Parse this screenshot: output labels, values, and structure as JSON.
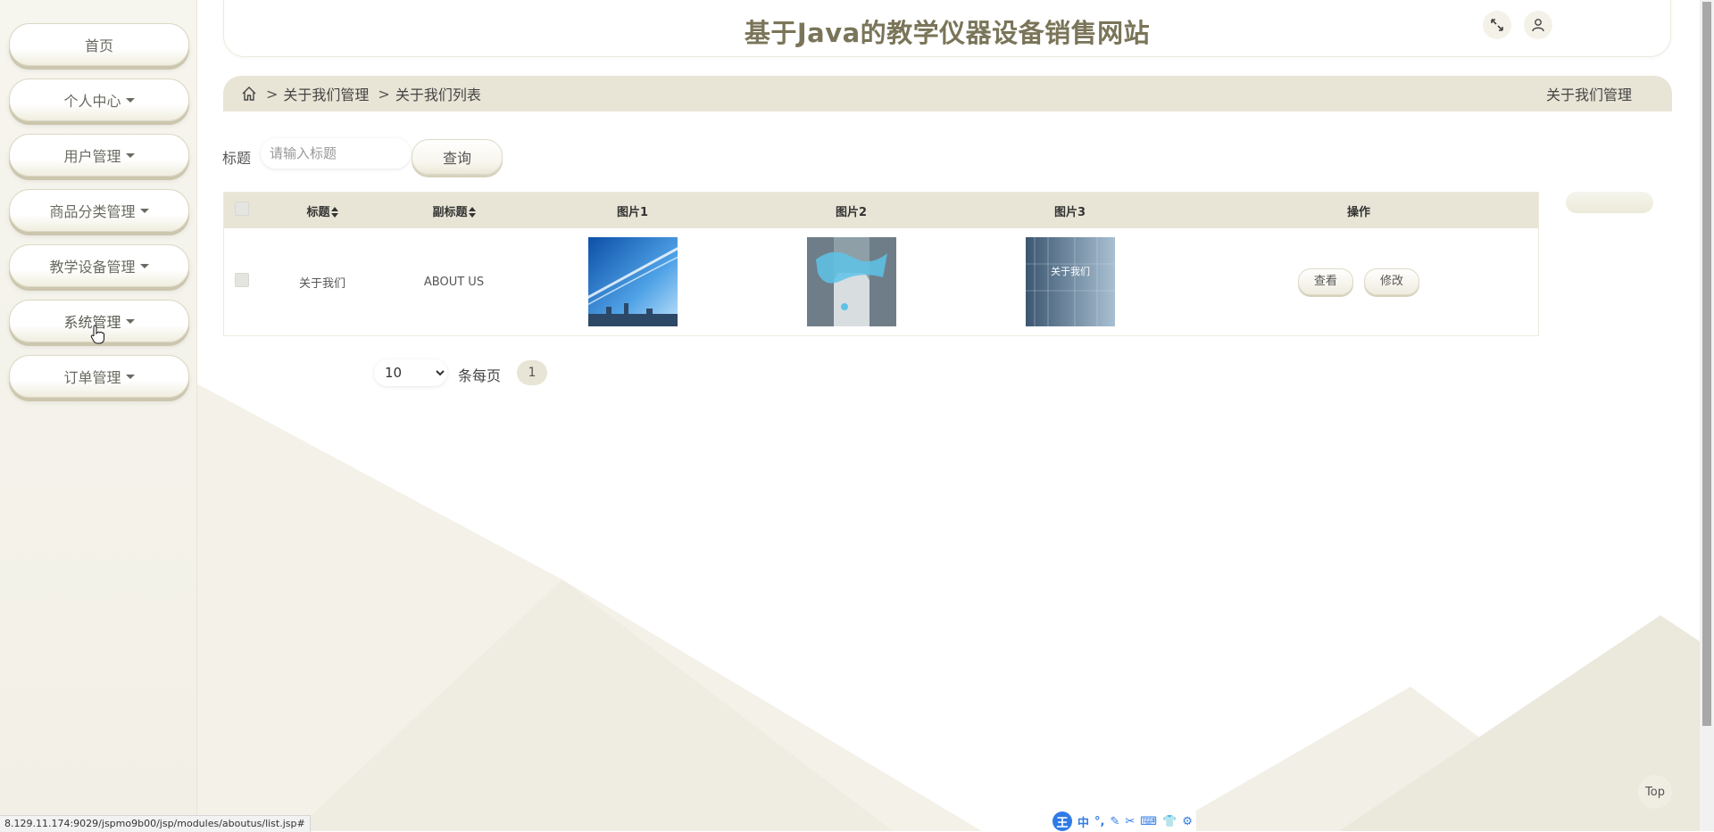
{
  "header": {
    "title": "基于Java的教学仪器设备销售网站"
  },
  "sidebar": {
    "items": [
      {
        "label": "首页",
        "has_caret": false
      },
      {
        "label": "个人中心",
        "has_caret": true
      },
      {
        "label": "用户管理",
        "has_caret": true
      },
      {
        "label": "商品分类管理",
        "has_caret": true
      },
      {
        "label": "教学设备管理",
        "has_caret": true
      },
      {
        "label": "系统管理",
        "has_caret": true
      },
      {
        "label": "订单管理",
        "has_caret": true
      }
    ]
  },
  "breadcrumb": {
    "sep": ">",
    "items": [
      "关于我们管理",
      "关于我们列表"
    ],
    "right_label": "关于我们管理"
  },
  "search": {
    "label": "标题",
    "placeholder": "请输入标题",
    "value": "",
    "button_label": "查询"
  },
  "table": {
    "columns": [
      "标题",
      "副标题",
      "图片1",
      "图片2",
      "图片3",
      "操作"
    ],
    "rows": [
      {
        "title": "关于我们",
        "subtitle": "ABOUT US",
        "image_labels": [
          "",
          "",
          "关于我们"
        ],
        "actions": [
          "查看",
          "修改"
        ]
      }
    ]
  },
  "pagination": {
    "page_size": "10",
    "page_size_options": [
      "10"
    ],
    "per_page_label": "条每页",
    "current_page": "1"
  },
  "top_button": "Top",
  "status_url": "8.129.11.174:9029/jspmo9b00/jsp/modules/aboutus/list.jsp#",
  "ime": {
    "logo": "王",
    "items": [
      "中",
      "°,",
      "✎",
      "✂",
      "⌨",
      "👕",
      "⚙"
    ]
  },
  "colors": {
    "accent": "#e8e5d6",
    "title": "#7a7559",
    "sidebar_bg": "#f4f2e8"
  }
}
